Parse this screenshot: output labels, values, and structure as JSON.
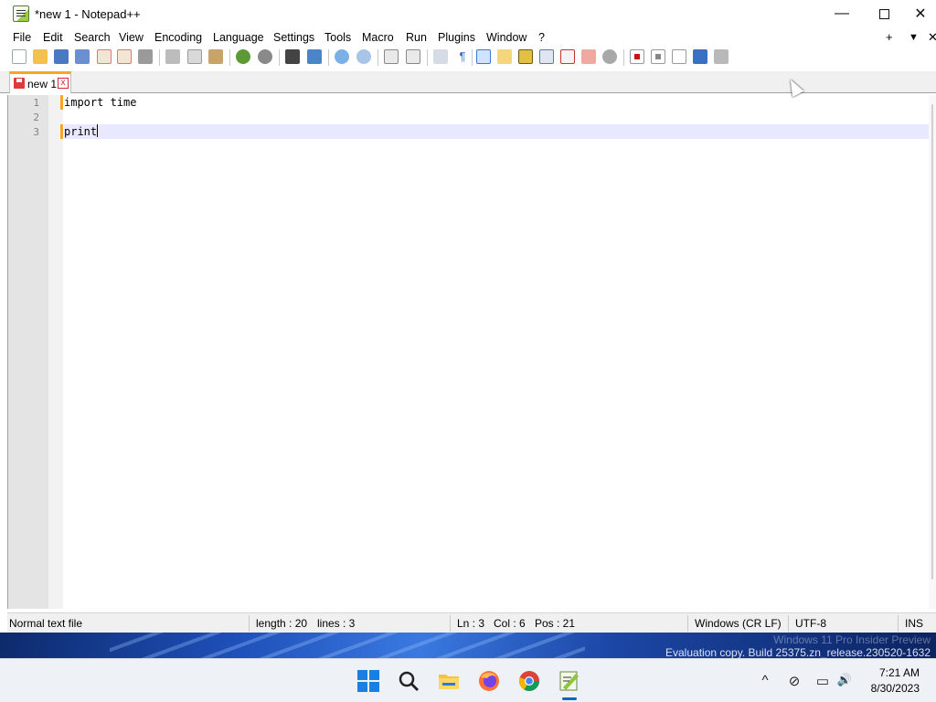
{
  "window": {
    "title": "*new 1 - Notepad++",
    "minimize_glyph": "—",
    "close_glyph": "✕"
  },
  "menu": {
    "items": [
      "File",
      "Edit",
      "Search",
      "View",
      "Encoding",
      "Language",
      "Settings",
      "Tools",
      "Macro",
      "Run",
      "Plugins",
      "Window",
      "?"
    ],
    "right": {
      "add": "+",
      "dropdown": "▼",
      "close": "✕"
    }
  },
  "toolbar": {
    "icons": [
      "new-file-icon",
      "open-file-icon",
      "save-icon",
      "save-all-icon",
      "close-icon",
      "close-all-icon",
      "print-icon",
      "cut-icon",
      "copy-icon",
      "paste-icon",
      "undo-icon",
      "redo-icon",
      "find-icon",
      "replace-icon",
      "zoom-in-icon",
      "zoom-out-icon",
      "sync-vertical-icon",
      "sync-horizontal-icon",
      "word-wrap-icon",
      "show-all-characters-icon",
      "indent-guide-icon",
      "user-language-icon",
      "document-map-icon",
      "document-list-icon",
      "function-list-icon",
      "folder-workspace-icon",
      "monitoring-icon",
      "record-macro-icon",
      "stop-record-icon",
      "playback-macro-icon",
      "run-macro-multiple-icon",
      "save-macro-icon"
    ]
  },
  "tabs": [
    {
      "label": "new 1",
      "close_glyph": "x"
    }
  ],
  "editor": {
    "lines": [
      {
        "number": "1",
        "text": "import time"
      },
      {
        "number": "2",
        "text": ""
      },
      {
        "number": "3",
        "text": "print"
      }
    ],
    "current_line": 3
  },
  "status": {
    "file_type": "Normal text file",
    "length": "length : 20",
    "lines": "lines : 3",
    "ln": "Ln : 3",
    "col": "Col : 6",
    "pos": "Pos : 21",
    "eol": "Windows (CR LF)",
    "encoding": "UTF-8",
    "mode": "INS"
  },
  "watermark": {
    "line1": "Windows 11 Pro Insider Preview",
    "line2": "Evaluation copy. Build 25375.zn_release.230520-1632"
  },
  "taskbar": {
    "apps": [
      "windows-start-icon",
      "search-icon",
      "file-explorer-icon",
      "firefox-icon",
      "chrome-icon",
      "notepadpp-icon"
    ],
    "tray": {
      "chevron": "^",
      "network": "⊘",
      "display": "▭",
      "volume": "🔊"
    },
    "clock": {
      "time": "7:21 AM",
      "date": "8/30/2023"
    }
  },
  "colors": {
    "tab_accent": "#f5a623",
    "current_line": "#e8e8ff",
    "taskbar_active": "#0067c0"
  }
}
